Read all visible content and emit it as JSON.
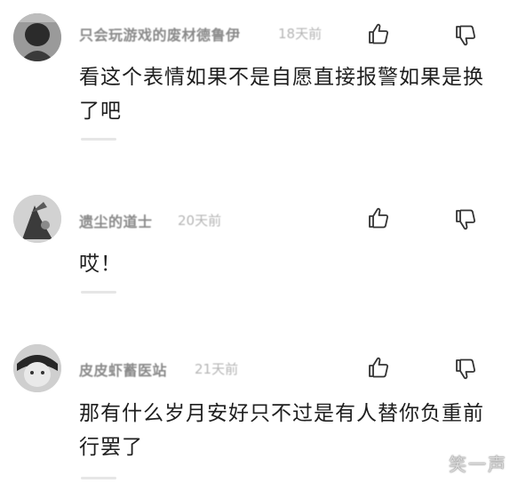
{
  "comments": [
    {
      "username": "只会玩游戏的废材德鲁伊",
      "time": "18天前",
      "text": "看这个表情如果不是自愿直接报警如果是换了吧"
    },
    {
      "username": "遗尘的道士",
      "time": "20天前",
      "text": "哎！"
    },
    {
      "username": "皮皮虾蓄医站",
      "time": "21天前",
      "text": "那有什么岁月安好只不过是有人替你负重前行罢了"
    }
  ],
  "watermark": "笑一声",
  "icons": {
    "like": "thumbs-up-icon",
    "dislike": "thumbs-down-icon"
  },
  "colors": {
    "username": "#8a8a8a",
    "time": "#b5b5b5",
    "text": "#1e1e1e"
  }
}
